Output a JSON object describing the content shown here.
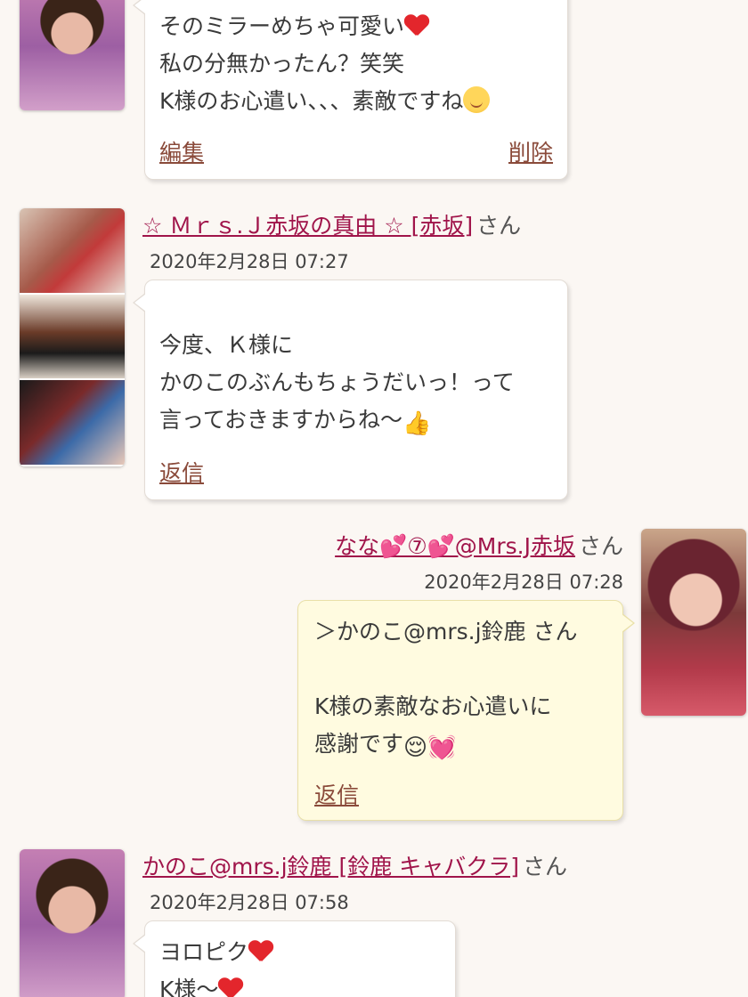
{
  "messages": [
    {
      "lines": [
        "そのミラーめちゃ可愛い",
        "私の分無かったん？笑笑",
        "K様のお心遣い、、、素敵ですね"
      ],
      "edit_label": "編集",
      "delete_label": "削除"
    },
    {
      "username": "☆ Ｍｒｓ.Ｊ赤坂の真由 ☆ [赤坂]",
      "suffix": "さん",
      "timestamp": "2020年2月28日 07:27",
      "lines": [
        "今度、Ｋ様に",
        "かのこのぶんもちょうだいっ！って",
        "言っておきますからね〜"
      ],
      "reply_label": "返信"
    },
    {
      "username": "なな💕⑦💕@Mrs.J赤坂",
      "suffix": "さん",
      "timestamp": "2020年2月28日 07:28",
      "lines": [
        "＞かのこ@mrs.j鈴鹿 さん",
        "",
        "K様の素敵なお心遣いに",
        "感謝です"
      ],
      "reply_label": "返信"
    },
    {
      "username": "かのこ@mrs.j鈴鹿 [鈴鹿 キャバクラ]",
      "suffix": "さん",
      "timestamp": "2020年2月28日 07:58",
      "lines": [
        "ヨロピク",
        "K様〜"
      ]
    }
  ]
}
